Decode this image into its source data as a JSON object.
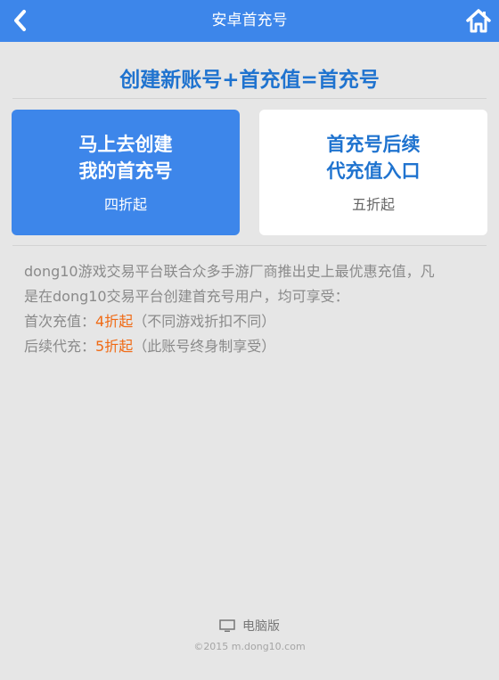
{
  "header": {
    "title": "安卓首充号",
    "back_icon": "chevron-left-icon",
    "home_icon": "home-icon",
    "color": "#3d86ea"
  },
  "headline": "创建新账号+首充值=首充号",
  "cards": [
    {
      "line1": "马上去创建",
      "line2": "我的首充号",
      "sub": "四折起"
    },
    {
      "line1": "首充号后续",
      "line2": "代充值入口",
      "sub": "五折起"
    }
  ],
  "description": {
    "intro_line1": "dong10游戏交易平台联合众多手游厂商推出史上最优惠充值，凡",
    "intro_line2": "是在dong10交易平台创建首充号用户，均可享受：",
    "first_label": "首次充值：",
    "first_highlight": "4折起",
    "first_note": "（不同游戏折扣不同）",
    "later_label": "后续代充：",
    "later_highlight": "5折起",
    "later_note": "（此账号终身制享受）",
    "highlight_color": "#f06a14"
  },
  "footer": {
    "desktop_icon": "monitor-icon",
    "desktop_label": "电脑版",
    "copyright": "©2015 m.dong10.com"
  }
}
